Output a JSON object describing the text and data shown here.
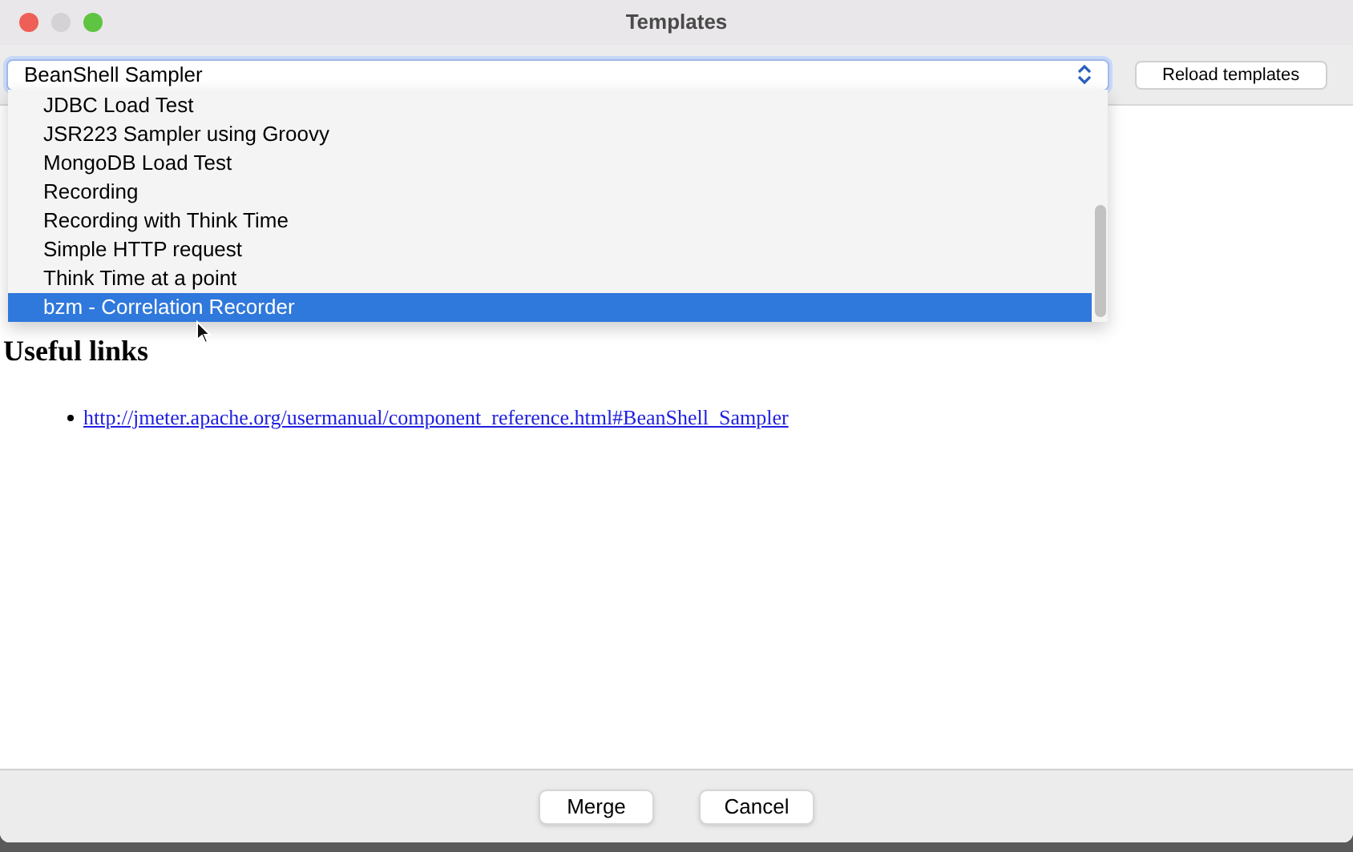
{
  "window": {
    "title": "Templates"
  },
  "template_select": {
    "value": "BeanShell Sampler"
  },
  "reload_button": "Reload templates",
  "dropdown": {
    "items": [
      {
        "label": "JDBC Load Test",
        "selected": false
      },
      {
        "label": "JSR223 Sampler using Groovy",
        "selected": false
      },
      {
        "label": "MongoDB Load Test",
        "selected": false
      },
      {
        "label": "Recording",
        "selected": false
      },
      {
        "label": "Recording with Think Time",
        "selected": false
      },
      {
        "label": "Simple HTTP request",
        "selected": false
      },
      {
        "label": "Think Time at a point",
        "selected": false
      },
      {
        "label": "bzm - Correlation Recorder",
        "selected": true
      }
    ]
  },
  "content": {
    "heading": "Useful links",
    "links": [
      "http://jmeter.apache.org/usermanual/component_reference.html#BeanShell_Sampler"
    ]
  },
  "buttons": [
    "Merge",
    "Cancel"
  ]
}
